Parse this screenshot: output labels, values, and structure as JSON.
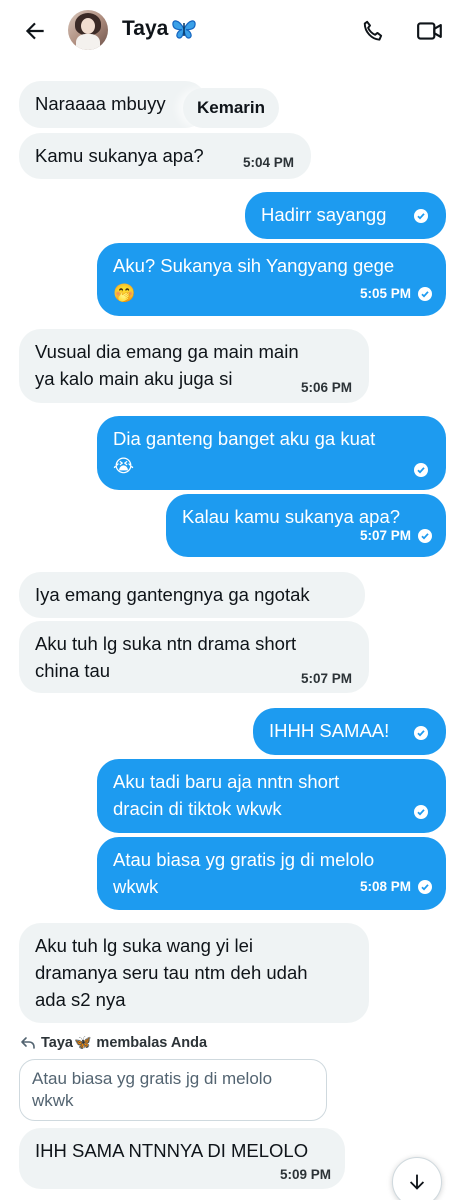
{
  "header": {
    "contact_name": "Taya",
    "name_emoji": "🦋",
    "back_icon": "arrow-left-icon",
    "call_icon": "phone-icon",
    "video_icon": "video-camera-icon"
  },
  "colors": {
    "accent": "#1d9bf0",
    "incoming_bubble": "#eff3f4",
    "text": "#0f1419"
  },
  "date_chip": "Kemarin",
  "messages": [
    {
      "side": "in",
      "text": "Naraaaa mbuyy",
      "time": ""
    },
    {
      "side": "in",
      "text": "Kamu sukanya apa?",
      "time": "5:04 PM"
    },
    {
      "side": "out",
      "text": "Hadirr sayangg",
      "time": ""
    },
    {
      "side": "out",
      "text": "Aku? Sukanya sih Yangyang gege",
      "emoji": "🤭",
      "time": "5:05 PM"
    },
    {
      "side": "in",
      "line1": "Vusual dia emang ga main main",
      "line2": "ya kalo main aku juga si",
      "time": "5:06 PM"
    },
    {
      "side": "out",
      "text": "Dia ganteng banget aku ga kuat",
      "emoji": "😭",
      "time": ""
    },
    {
      "side": "out",
      "text": "Kalau kamu sukanya apa?",
      "time": "5:07 PM"
    },
    {
      "side": "in",
      "text": "Iya emang gantengnya ga ngotak",
      "time": ""
    },
    {
      "side": "in",
      "line1": "Aku tuh lg suka ntn drama short",
      "line2": "china tau",
      "time": "5:07 PM"
    },
    {
      "side": "out",
      "text": "IHHH SAMAA!",
      "time": ""
    },
    {
      "side": "out",
      "line1": "Aku tadi baru aja nntn short",
      "line2": "dracin di tiktok wkwk",
      "time": ""
    },
    {
      "side": "out",
      "line1": "Atau biasa yg gratis jg di melolo",
      "line2": "wkwk",
      "time": "5:08 PM"
    },
    {
      "side": "in",
      "line1": "Aku tuh lg suka wang yi lei",
      "line2": "dramanya seru tau ntm deh udah",
      "line3": "ada s2 nya",
      "time": ""
    },
    {
      "side": "in",
      "text": "IHH SAMA NTNNYA DI MELOLO",
      "time": "5:09 PM"
    }
  ],
  "reply": {
    "replier": "Taya",
    "emoji": "🦋",
    "action": "membalas Anda",
    "icon": "reply-arrow-icon",
    "quoted_line1": "Atau biasa yg gratis jg di melolo",
    "quoted_line2": "wkwk"
  },
  "scroll_button_icon": "arrow-down-icon"
}
